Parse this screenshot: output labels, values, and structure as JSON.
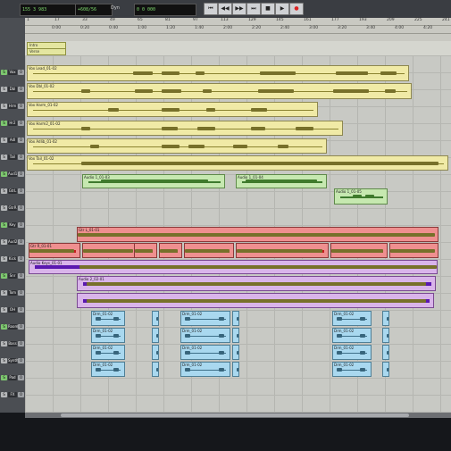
{
  "transport": {
    "counter_main": "155 3 983",
    "counter_sub": "+608/56",
    "counter_right": "0 0 000",
    "btn_rtz": "⏮",
    "btn_rew": "◀◀",
    "btn_ffwd": "▶▶",
    "btn_end": "⏭",
    "btn_stop": "■",
    "btn_play": "▶",
    "btn_rec": "●",
    "label_dyn": "Dyn"
  },
  "ruler": {
    "bars": [
      "1",
      "17",
      "33",
      "49",
      "65",
      "81",
      "97",
      "113",
      "129",
      "145",
      "161",
      "177",
      "193",
      "209",
      "225",
      "241"
    ],
    "timecode": [
      "0:00",
      "0:20",
      "0:40",
      "1:00",
      "1:20",
      "1:40",
      "2:00",
      "2:20",
      "2:40",
      "3:00",
      "3:20",
      "3:40",
      "4:00",
      "4:20",
      "4:40"
    ]
  },
  "markers": [
    "Intro",
    "Verse"
  ],
  "tracks": [
    {
      "clips": [
        {
          "name": "Vox Lead_01-02",
          "type": "y"
        }
      ]
    },
    {
      "clips": [
        {
          "name": "Vox Dbl_01-02",
          "type": "y"
        }
      ]
    },
    {
      "clips": [
        {
          "name": "Vox Harm_01-02",
          "type": "y"
        }
      ]
    },
    {
      "clips": [
        {
          "name": "Vox Harm2_01-02",
          "type": "y"
        }
      ]
    },
    {
      "clips": [
        {
          "name": "Vox Adlib_01-02",
          "type": "y"
        }
      ]
    },
    {
      "clips": [
        {
          "name": "Vox Tail_01-02",
          "type": "y"
        }
      ]
    },
    {
      "clips": [
        {
          "name": "Audio 1_01-03",
          "type": "g"
        },
        {
          "name": "Audio 1_01-04",
          "type": "g"
        },
        {
          "name": "Audio 1_01-05",
          "type": "g"
        }
      ]
    },
    {
      "clips": [
        {
          "name": "Gtr L_01-01",
          "type": "r"
        }
      ]
    },
    {
      "clips": [
        {
          "name": "Gtr R_01-01",
          "type": "r"
        }
      ]
    },
    {
      "clips": [
        {
          "name": "Audio Keys_01-01",
          "type": "p"
        }
      ]
    },
    {
      "clips": [
        {
          "name": "Audio 2_02-01",
          "type": "p"
        }
      ]
    },
    {
      "clips": [
        {
          "name": "Drm_01-02",
          "type": "b"
        }
      ]
    }
  ],
  "header_labels": [
    "Vox",
    "Dbl",
    "Hrm",
    "Hr2",
    "Adl",
    "Tail",
    "Aud1",
    "GtrL",
    "GtrR",
    "Key",
    "Aud2",
    "Kick",
    "Snr",
    "Tom",
    "OH",
    "Room",
    "Bass",
    "Synth",
    "Pad",
    "FX"
  ],
  "colors": {
    "vocal": "#f0eaa6",
    "green": "#c6e8b0",
    "guitar": "#ef8f8f",
    "keys": "#d9b4ea",
    "drums": "#a9d8ef"
  }
}
